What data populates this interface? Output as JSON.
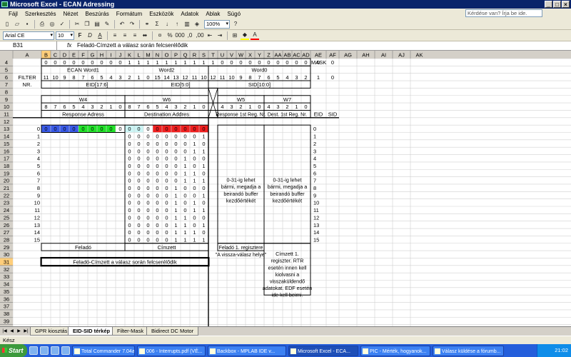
{
  "window": {
    "title": "Microsoft Excel - ECAN Adressing"
  },
  "menu": {
    "items": [
      "Fájl",
      "Szerkesztés",
      "Nézet",
      "Beszúrás",
      "Formátum",
      "Eszközök",
      "Adatok",
      "Ablak",
      "Súgó"
    ],
    "help_placeholder": "Kérdése van? Írja be ide."
  },
  "toolbar": {
    "zoom": "100%",
    "font": "Arial CE",
    "size": "10"
  },
  "formula": {
    "cell": "B31",
    "fx": "fx",
    "value": "Feladó-Címzett a válasz során felcserélődik"
  },
  "grid": {
    "columns": [
      "A",
      "B",
      "C",
      "D",
      "E",
      "F",
      "G",
      "H",
      "I",
      "J",
      "K",
      "L",
      "M",
      "N",
      "O",
      "P",
      "Q",
      "R",
      "S",
      "T",
      "U",
      "V",
      "W",
      "X",
      "Y",
      "Z",
      "AA",
      "AB",
      "AC",
      "AD",
      "AE",
      "AF",
      "AG",
      "AH",
      "AI",
      "AJ",
      "AK"
    ],
    "row_numbers": [
      "4",
      "5",
      "6",
      "7",
      "8",
      "9",
      "10",
      "11",
      "12",
      "13",
      "14",
      "15",
      "16",
      "17",
      "18",
      "19",
      "20",
      "21",
      "22",
      "23",
      "24",
      "25",
      "26",
      "27",
      "28",
      "29",
      "30",
      "31",
      "32",
      "33",
      "34",
      "35",
      "36",
      "37",
      "38",
      "39",
      "40"
    ],
    "mask_row": [
      "0",
      "0",
      "0",
      "0",
      "0",
      "0",
      "0",
      "0",
      "0",
      "1",
      "1",
      "1",
      "1",
      "1",
      "1",
      "1",
      "1",
      "1",
      "1",
      "0",
      "0",
      "0",
      "0",
      "0",
      "0",
      "0",
      "0",
      "0",
      "0",
      "0",
      "0"
    ],
    "mask_label": "MASK",
    "word1": "ECAN Word1",
    "word2": "Word2",
    "word0": "Word0",
    "filter_label": "FILTER",
    "nr_label": "NR.",
    "bits_word1": [
      "11",
      "10",
      "9",
      "8",
      "7",
      "6",
      "5",
      "4",
      "3"
    ],
    "bits_word2a": [
      "2",
      "1",
      "0"
    ],
    "bits_word2b": [
      "15",
      "14",
      "13",
      "12",
      "11",
      "10"
    ],
    "bits_word0": [
      "12",
      "11",
      "10",
      "9",
      "8",
      "7",
      "6",
      "5",
      "4",
      "3",
      "2"
    ],
    "filter_vals": [
      "1",
      "0"
    ],
    "eid17": "EID[17:6]",
    "eid5": "EID[5:0]",
    "sid10": "SID[10:0]",
    "w4": "W4",
    "w6": "W6",
    "w5": "W5",
    "w7": "W7",
    "bits_w4": [
      "8",
      "7",
      "6",
      "5",
      "4",
      "3",
      "2",
      "1",
      "0"
    ],
    "bits_w6": [
      "8",
      "7",
      "6",
      "5",
      "4",
      "3",
      "2",
      "1",
      "0"
    ],
    "bits_w5": [
      "4",
      "3",
      "2",
      "1",
      "0"
    ],
    "bits_w7": [
      "4",
      "3",
      "2",
      "1",
      "0"
    ],
    "response_addr": "Response Adress",
    "dest_addr": "Destination Addres",
    "response_reg": "Response 1st Reg. Nr.",
    "dest_reg": "Dest. 1st Reg. Nr.",
    "eid_hdr": "EID",
    "sid_hdr": "SID",
    "row13_a": "0",
    "row13_w4": [
      "0",
      "0",
      "0",
      "0",
      "0",
      "0",
      "0",
      "0",
      "0"
    ],
    "row13_w6": [
      "0",
      "0",
      "0",
      "0",
      "0",
      "0",
      "0",
      "0",
      "0"
    ],
    "indices": [
      "1",
      "2",
      "3",
      "4",
      "5",
      "6",
      "7",
      "8",
      "9",
      "10",
      "11",
      "12",
      "13",
      "14",
      "15"
    ],
    "w6_rows": [
      [
        "0",
        "0",
        "0",
        "0",
        "0",
        "0",
        "0",
        "0",
        "1"
      ],
      [
        "0",
        "0",
        "0",
        "0",
        "0",
        "0",
        "0",
        "1",
        "0"
      ],
      [
        "0",
        "0",
        "0",
        "0",
        "0",
        "0",
        "0",
        "1",
        "1"
      ],
      [
        "0",
        "0",
        "0",
        "0",
        "0",
        "0",
        "1",
        "0",
        "0"
      ],
      [
        "0",
        "0",
        "0",
        "0",
        "0",
        "0",
        "1",
        "0",
        "1"
      ],
      [
        "0",
        "0",
        "0",
        "0",
        "0",
        "0",
        "1",
        "1",
        "0"
      ],
      [
        "0",
        "0",
        "0",
        "0",
        "0",
        "0",
        "1",
        "1",
        "1"
      ],
      [
        "0",
        "0",
        "0",
        "0",
        "0",
        "1",
        "0",
        "0",
        "0"
      ],
      [
        "0",
        "0",
        "0",
        "0",
        "0",
        "1",
        "0",
        "0",
        "1"
      ],
      [
        "0",
        "0",
        "0",
        "0",
        "0",
        "1",
        "0",
        "1",
        "0"
      ],
      [
        "0",
        "0",
        "0",
        "0",
        "0",
        "1",
        "0",
        "1",
        "1"
      ],
      [
        "0",
        "0",
        "0",
        "0",
        "0",
        "1",
        "1",
        "0",
        "0"
      ],
      [
        "0",
        "0",
        "0",
        "0",
        "0",
        "1",
        "1",
        "0",
        "1"
      ],
      [
        "0",
        "0",
        "0",
        "0",
        "0",
        "1",
        "1",
        "1",
        "0"
      ],
      [
        "0",
        "0",
        "0",
        "0",
        "0",
        "1",
        "1",
        "1",
        "1"
      ]
    ],
    "eid_col": [
      "0",
      "1",
      "2",
      "3",
      "4",
      "5",
      "6",
      "7",
      "8",
      "9",
      "10",
      "11",
      "12",
      "13",
      "14",
      "15"
    ],
    "box_text": "0-31-ig lehet bármi, megadja a beirandó buffer kezdőértékét",
    "felado": "Feladó",
    "cimzett": "Címzett",
    "felado_reg": "Feladó 1. regisztere",
    "vissza": "\"A vissza-válasz helye\"",
    "cimzett_reg": "Címzett 1. regiszter. RTR esetén innen kell kiolvasni a visszaküldendő adatokat. EDF esetén ide kell beirni.",
    "swap_note": "Feladó-Címzett a válasz során felcserélődik"
  },
  "sheets": [
    "GPR kiosztás",
    "EID-SID térkép",
    "Filter-Mask",
    "Bidirect DC Motor"
  ],
  "status": "Kész",
  "taskbar": {
    "start": "Start",
    "tasks": [
      "Total Commander 7.04a...",
      "006 - Interrupts.pdf (VÉ...",
      "Backbox - MPLAB IDE v...",
      "Microsoft Excel - ECA...",
      "PIC - Mérték, hogyanok...",
      "Válasz küldése a fórumb..."
    ],
    "active_index": 3,
    "time": "21:02"
  },
  "colors": {
    "blue": "#3a5be8",
    "green": "#22e32a",
    "cyan": "#ccf5f5",
    "red": "#f02020",
    "header": "#d4d0c8",
    "selected_header": "#ffce7b",
    "title": "#0a246a"
  }
}
